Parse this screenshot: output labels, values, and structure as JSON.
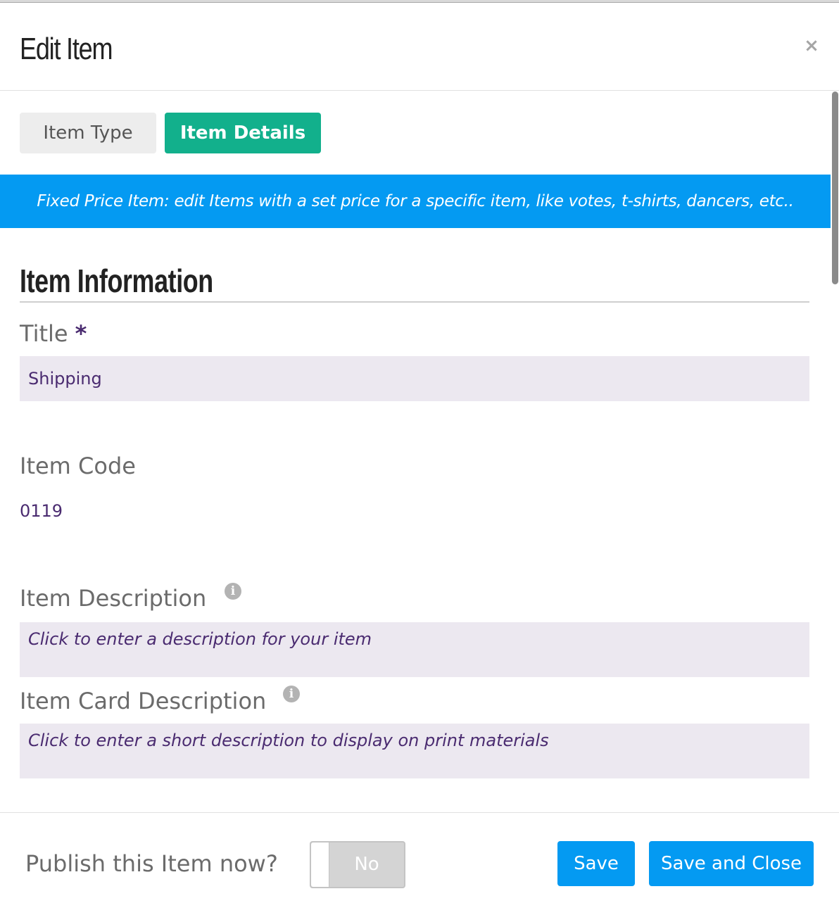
{
  "modal": {
    "title": "Edit Item",
    "close_symbol": "×"
  },
  "tabs": [
    {
      "label": "Item Type",
      "active": false
    },
    {
      "label": "Item Details",
      "active": true
    }
  ],
  "banner": {
    "text": "Fixed Price Item: edit Items with a set price for a specific item, like votes, t-shirts, dancers, etc.."
  },
  "section": {
    "heading": "Item Information"
  },
  "fields": {
    "title": {
      "label": "Title",
      "required_mark": "*",
      "value": "Shipping"
    },
    "item_code": {
      "label": "Item Code",
      "value": "0119"
    },
    "item_description": {
      "label": "Item Description",
      "placeholder": "Click to enter a description for your item",
      "info_icon": "i"
    },
    "item_card_description": {
      "label": "Item Card Description",
      "placeholder": "Click to enter a short description to display on print materials",
      "info_icon": "i"
    }
  },
  "footer": {
    "publish_label": "Publish this Item now?",
    "publish_toggle": "No",
    "save_label": "Save",
    "save_close_label": "Save and Close"
  },
  "colors": {
    "accent_green": "#12b08c",
    "accent_blue": "#049af2",
    "input_bg": "#ece8f0",
    "value_text": "#4a2b70"
  },
  "icons": {
    "close": "close-icon",
    "info": "info-icon"
  }
}
